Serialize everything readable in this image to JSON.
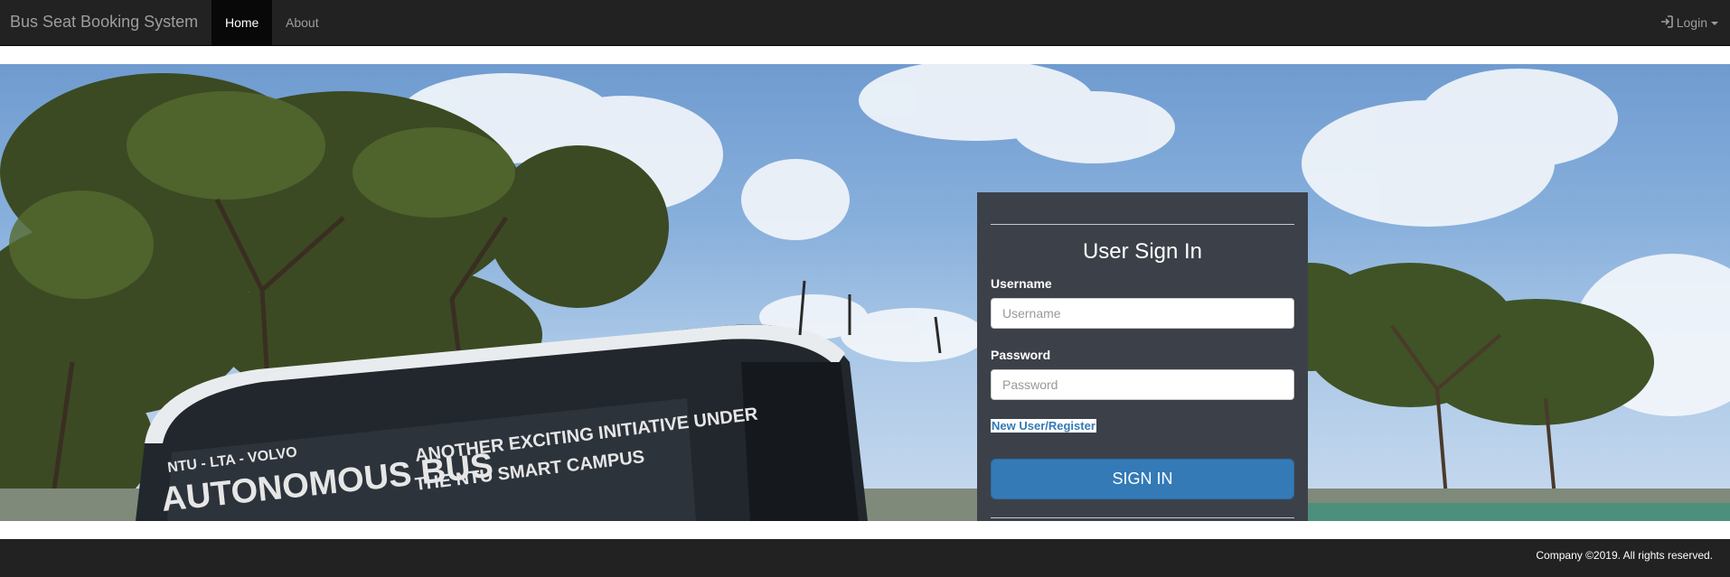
{
  "navbar": {
    "brand": "Bus Seat Booking System",
    "items": [
      {
        "label": "Home",
        "active": true
      },
      {
        "label": "About",
        "active": false
      }
    ],
    "login_label": "Login",
    "login_icon": "sign-in-icon"
  },
  "hero": {
    "bus_text": {
      "small": "NTU - LTA - VOLVO",
      "big": "AUTONOMOUS BUS",
      "line1": "ANOTHER EXCITING INITIATIVE UNDER",
      "line2": "THE NTU SMART CAMPUS"
    }
  },
  "login_form": {
    "title": "User Sign In",
    "username_label": "Username",
    "username_placeholder": "Username",
    "username_value": "",
    "password_label": "Password",
    "password_placeholder": "Password",
    "password_value": "",
    "register_link": "New User/Register",
    "submit_label": "SIGN IN"
  },
  "footer": {
    "text": "Company ©2019. All rights reserved."
  },
  "colors": {
    "navbar_bg": "#222222",
    "card_bg": "#3c4149",
    "primary": "#337ab7",
    "link": "#337ab7"
  }
}
